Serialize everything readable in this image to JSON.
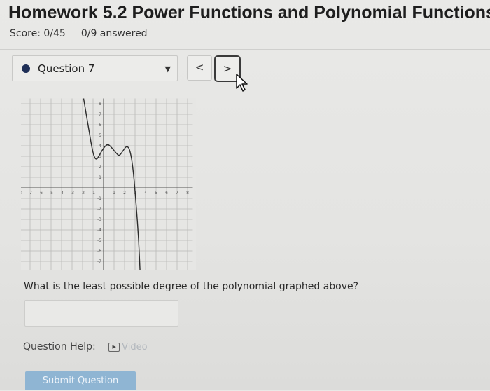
{
  "header": {
    "title": "Homework 5.2 Power Functions and Polynomial Functions",
    "score": "Score: 0/45",
    "answered": "0/9 answered"
  },
  "question_nav": {
    "selected": "Question 7",
    "prev_label": "<",
    "next_label": ">"
  },
  "graph": {
    "x_tick_labels": [
      "-8",
      "-7",
      "-6",
      "-5",
      "-4",
      "-3",
      "-2",
      "-1",
      "1",
      "2",
      "3",
      "4",
      "5",
      "6",
      "7",
      "8"
    ],
    "y_tick_labels": [
      "8",
      "7",
      "6",
      "5",
      "4",
      "3",
      "2",
      "1",
      "-1",
      "-2",
      "-3",
      "-4",
      "-5",
      "-6",
      "-7",
      "-8"
    ]
  },
  "question": {
    "text": "What is the least possible degree of the polynomial graphed above?"
  },
  "help": {
    "label": "Question Help:",
    "video_icon": "▶",
    "video_label": "Video"
  },
  "submit": {
    "label": "Submit Question"
  },
  "colors": {
    "submit_bg": "#8fb5d3",
    "question_dot": "#1f2f57"
  },
  "icons": {
    "dropdown": "caret-down-icon",
    "cursor": "mouse-pointer-icon",
    "video": "video-icon"
  }
}
